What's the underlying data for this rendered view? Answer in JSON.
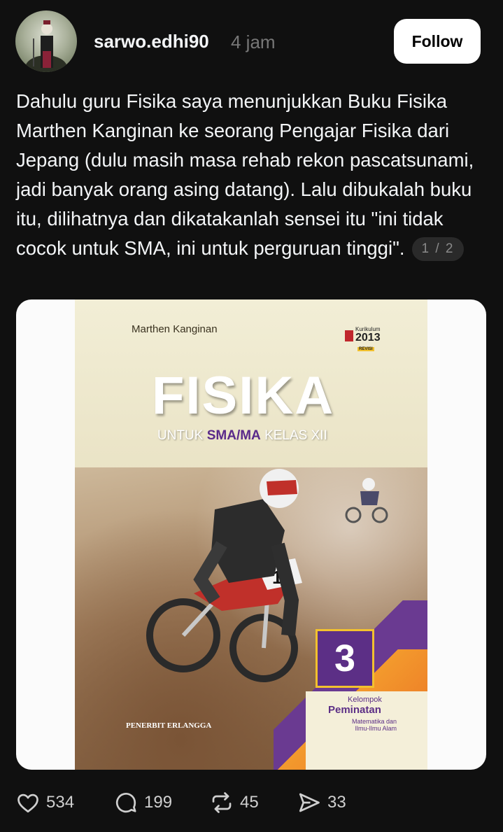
{
  "post": {
    "username": "sarwo.edhi90",
    "time": "4 jam",
    "follow_label": "Follow",
    "text": "Dahulu guru Fisika saya menunjukkan Buku Fisika Marthen Kanginan ke seorang Pengajar Fisika dari Jepang (dulu masih masa rehab rekon pascatsunami, jadi banyak orang asing datang). Lalu dibukalah buku itu, dilihatnya dan dikatakanlah sensei itu \"ini tidak cocok untuk SMA, ini untuk perguruan tinggi\".",
    "page_indicator": "1 / 2"
  },
  "book": {
    "author": "Marthen Kanginan",
    "kurikulum_label": "Kurikulum",
    "kurikulum_year": "2013",
    "kurikulum_revisi": "REVISI",
    "title": "FISIKA",
    "subtitle_pre": "UNTUK ",
    "subtitle_em": "SMA/MA",
    "subtitle_post": " KELAS XII",
    "volume": "3",
    "kelompok": "Kelompok",
    "peminatan": "Peminatan",
    "matematika_1": "Matematika dan",
    "matematika_2": "Ilmu-Ilmu Alam",
    "publisher": "PENERBIT ERLANGGA"
  },
  "actions": {
    "likes": "534",
    "replies": "199",
    "reposts": "45",
    "shares": "33"
  },
  "icons": [
    "heart-icon",
    "comment-icon",
    "repost-icon",
    "share-icon"
  ],
  "colors": {
    "background": "#101010",
    "text": "#f3f5f7",
    "muted": "#777777",
    "book_purple": "#5c2f86"
  }
}
